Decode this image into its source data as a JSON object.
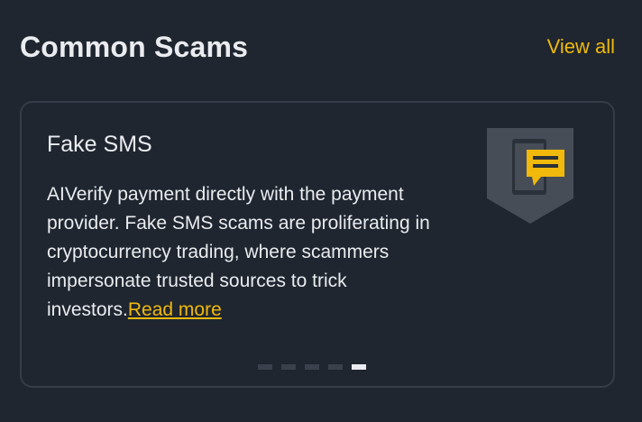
{
  "header": {
    "title": "Common Scams",
    "view_all_label": "View all"
  },
  "card": {
    "title": "Fake SMS",
    "body": "AIVerify payment directly with the payment provider. Fake SMS scams are proliferating in cryptocurrency trading, where scammers impersonate trusted sources to trick investors.",
    "read_more_label": "Read more",
    "icon": "phone-message-shield-icon"
  },
  "pager": {
    "total": 5,
    "active_index": 4
  },
  "colors": {
    "background": "#1f2630",
    "accent": "#f0b90b",
    "card_border": "#363d48",
    "text": "#eaecef"
  }
}
